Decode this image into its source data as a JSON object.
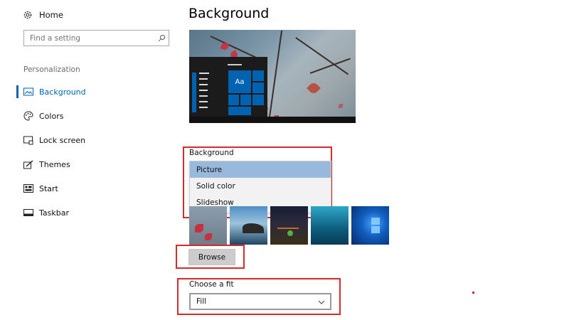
{
  "sidebar": {
    "home": {
      "label": "Home",
      "icon": "gear-icon"
    },
    "search": {
      "placeholder": "Find a setting",
      "icon": "search-icon"
    },
    "section_label": "Personalization",
    "items": [
      {
        "label": "Background",
        "icon": "picture-icon",
        "active": true
      },
      {
        "label": "Colors",
        "icon": "palette-icon",
        "active": false
      },
      {
        "label": "Lock screen",
        "icon": "lock-screen-icon",
        "active": false
      },
      {
        "label": "Themes",
        "icon": "brush-icon",
        "active": false
      },
      {
        "label": "Start",
        "icon": "start-icon",
        "active": false
      },
      {
        "label": "Taskbar",
        "icon": "taskbar-icon",
        "active": false
      }
    ]
  },
  "main": {
    "title": "Background",
    "preview": {
      "tile_label": "Aa"
    },
    "background_section": {
      "label": "Background",
      "options": [
        "Picture",
        "Solid color",
        "Slideshow"
      ],
      "selected": "Picture"
    },
    "browse_label": "Browse",
    "fit_section": {
      "label": "Choose a fit",
      "value": "Fill"
    }
  },
  "colors": {
    "accent": "#0063b1",
    "highlight_box": "#d52b2b",
    "selected_option": "#99b9dc"
  }
}
